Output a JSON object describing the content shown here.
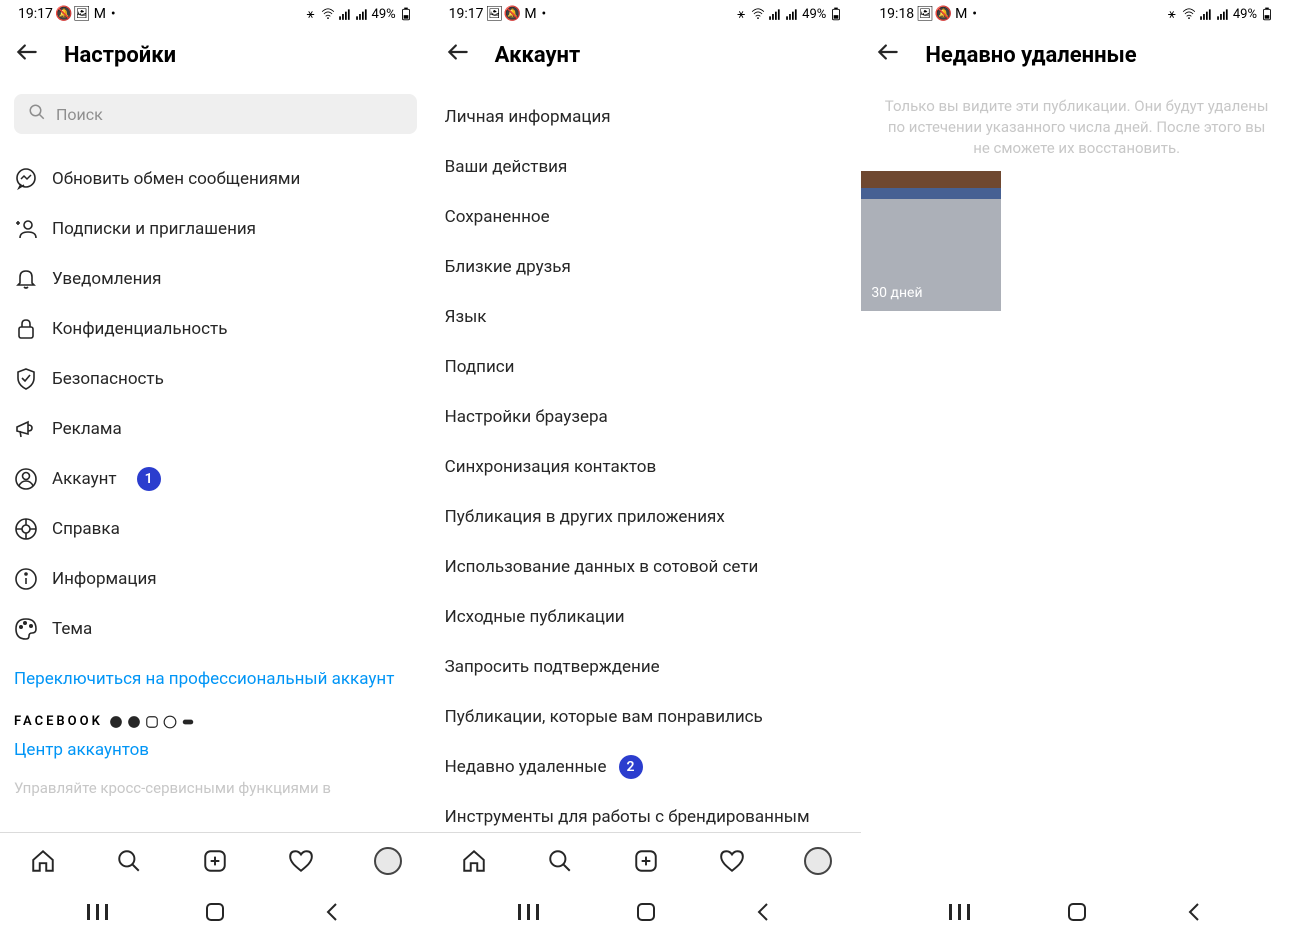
{
  "status": {
    "time1": "19:17",
    "time2": "19:17",
    "time3": "19:18",
    "battery": "49%"
  },
  "screen1": {
    "title": "Настройки",
    "search_placeholder": "Поиск",
    "items": [
      {
        "label": "Обновить обмен сообщениями",
        "icon": "messenger"
      },
      {
        "label": "Подписки и приглашения",
        "icon": "user-plus"
      },
      {
        "label": "Уведомления",
        "icon": "bell"
      },
      {
        "label": "Конфиденциальность",
        "icon": "lock"
      },
      {
        "label": "Безопасность",
        "icon": "shield"
      },
      {
        "label": "Реклама",
        "icon": "megaphone"
      },
      {
        "label": "Аккаунт",
        "icon": "user",
        "badge": "1"
      },
      {
        "label": "Справка",
        "icon": "help"
      },
      {
        "label": "Информация",
        "icon": "info"
      },
      {
        "label": "Тема",
        "icon": "palette"
      }
    ],
    "switch_link": "Переключиться на профессиональный аккаунт",
    "facebook_label": "FACEBOOK",
    "accounts_center": "Центр аккаунтов",
    "faded": "Управляйте кросс-сервисными функциями в"
  },
  "screen2": {
    "title": "Аккаунт",
    "items": [
      "Личная информация",
      "Ваши действия",
      "Сохраненное",
      "Близкие друзья",
      "Язык",
      "Подписи",
      "Настройки браузера",
      "Синхронизация контактов",
      "Публикация в других приложениях",
      "Использование данных в сотовой сети",
      "Исходные публикации",
      "Запросить подтверждение",
      "Публикации, которые вам понравились",
      "Недавно удаленные",
      "Инструменты для работы с брендированным"
    ],
    "badge_index": 13,
    "badge_label": "2"
  },
  "screen3": {
    "title": "Недавно удаленные",
    "info": "Только вы видите эти публикации. Они будут удалены по истечении указанного числа дней. После этого вы не сможете их восстановить.",
    "thumb_label": "30 дней"
  }
}
